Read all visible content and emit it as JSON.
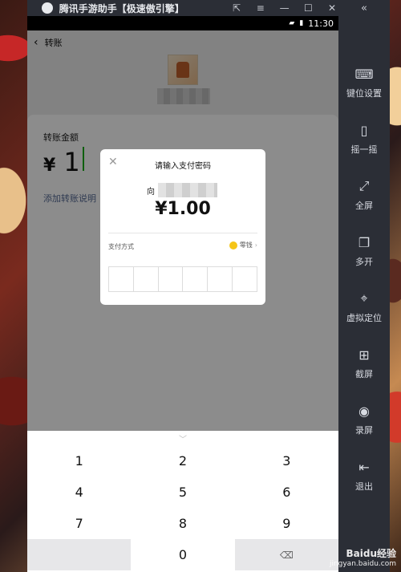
{
  "window": {
    "title": "腾讯手游助手【极速傲引擎】",
    "controls": [
      "open-external",
      "menu",
      "minimize",
      "maximize",
      "close"
    ]
  },
  "status_bar": {
    "time": "11:30"
  },
  "header": {
    "back_icon": "chevron-left",
    "title": "转账"
  },
  "transfer": {
    "amount_label": "转账金额",
    "currency": "¥",
    "amount": "1",
    "add_note": "添加转账说明"
  },
  "dialog": {
    "title": "请输入支付密码",
    "to_prefix": "向",
    "amount": "¥1.00",
    "pay_method_label": "支付方式",
    "pay_method_value": "零钱",
    "pin_cells": 6
  },
  "keypad": {
    "keys": [
      "1",
      "2",
      "3",
      "4",
      "5",
      "6",
      "7",
      "8",
      "9",
      "",
      "0",
      "⌫"
    ]
  },
  "sidebar": {
    "items": [
      {
        "label": "键位设置",
        "icon": "keyboard-icon"
      },
      {
        "label": "摇一摇",
        "icon": "phone-shake-icon"
      },
      {
        "label": "全屏",
        "icon": "fullscreen-icon"
      },
      {
        "label": "多开",
        "icon": "multi-window-icon"
      },
      {
        "label": "虚拟定位",
        "icon": "location-target-icon"
      },
      {
        "label": "截屏",
        "icon": "screenshot-icon"
      },
      {
        "label": "录屏",
        "icon": "record-icon"
      },
      {
        "label": "退出",
        "icon": "exit-icon"
      }
    ]
  },
  "watermark": {
    "brand": "Baidu经验",
    "url": "jingyan.baidu.com"
  }
}
